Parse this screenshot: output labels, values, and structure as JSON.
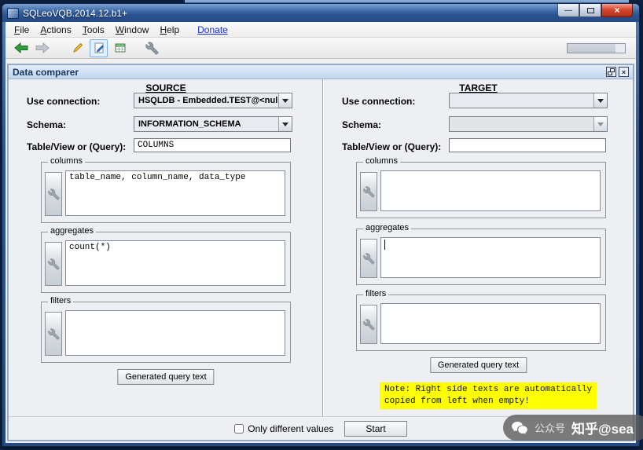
{
  "window": {
    "title": "SQLeoVQB.2014.12.b1+",
    "minimize_glyph": "—",
    "close_glyph": "×"
  },
  "menu": {
    "items": [
      {
        "mnemonic": "F",
        "rest": "ile"
      },
      {
        "mnemonic": "A",
        "rest": "ctions"
      },
      {
        "mnemonic": "T",
        "rest": "ools"
      },
      {
        "mnemonic": "W",
        "rest": "indow"
      },
      {
        "mnemonic": "H",
        "rest": "elp"
      }
    ],
    "donate_label": "Donate"
  },
  "toolbar": {
    "icons": [
      "back-arrow-icon",
      "forward-arrow-icon",
      "pencil-yellow-icon",
      "edit-document-icon",
      "table-grid-icon",
      "wrench-icon"
    ]
  },
  "frame": {
    "title": "Data comparer",
    "source": {
      "heading": "SOURCE",
      "connection_label": "Use connection:",
      "connection_value": "HSQLDB - Embedded.TEST@<null>",
      "schema_label": "Schema:",
      "schema_value": "INFORMATION_SCHEMA",
      "table_label": "Table/View or (Query):",
      "table_value": "COLUMNS",
      "columns_label": "columns",
      "columns_text": "table_name, column_name, data_type",
      "aggregates_label": "aggregates",
      "aggregates_text": "count(*)",
      "filters_label": "filters",
      "filters_text": "",
      "generated_button": "Generated query text"
    },
    "target": {
      "heading": "TARGET",
      "connection_label": "Use connection:",
      "connection_value": "",
      "schema_label": "Schema:",
      "schema_value": "",
      "table_label": "Table/View or (Query):",
      "table_value": "",
      "columns_label": "columns",
      "columns_text": "",
      "aggregates_label": "aggregates",
      "aggregates_text": "",
      "filters_label": "filters",
      "filters_text": "",
      "generated_button": "Generated query text",
      "note_line1": "Note: Right side texts are automatically",
      "note_line2": "copied from left when empty!"
    },
    "footer": {
      "only_different_label": "Only different values",
      "checked": false,
      "start_label": "Start"
    }
  },
  "watermark": {
    "prefix": "公众号",
    "handle": "知乎@sea"
  }
}
